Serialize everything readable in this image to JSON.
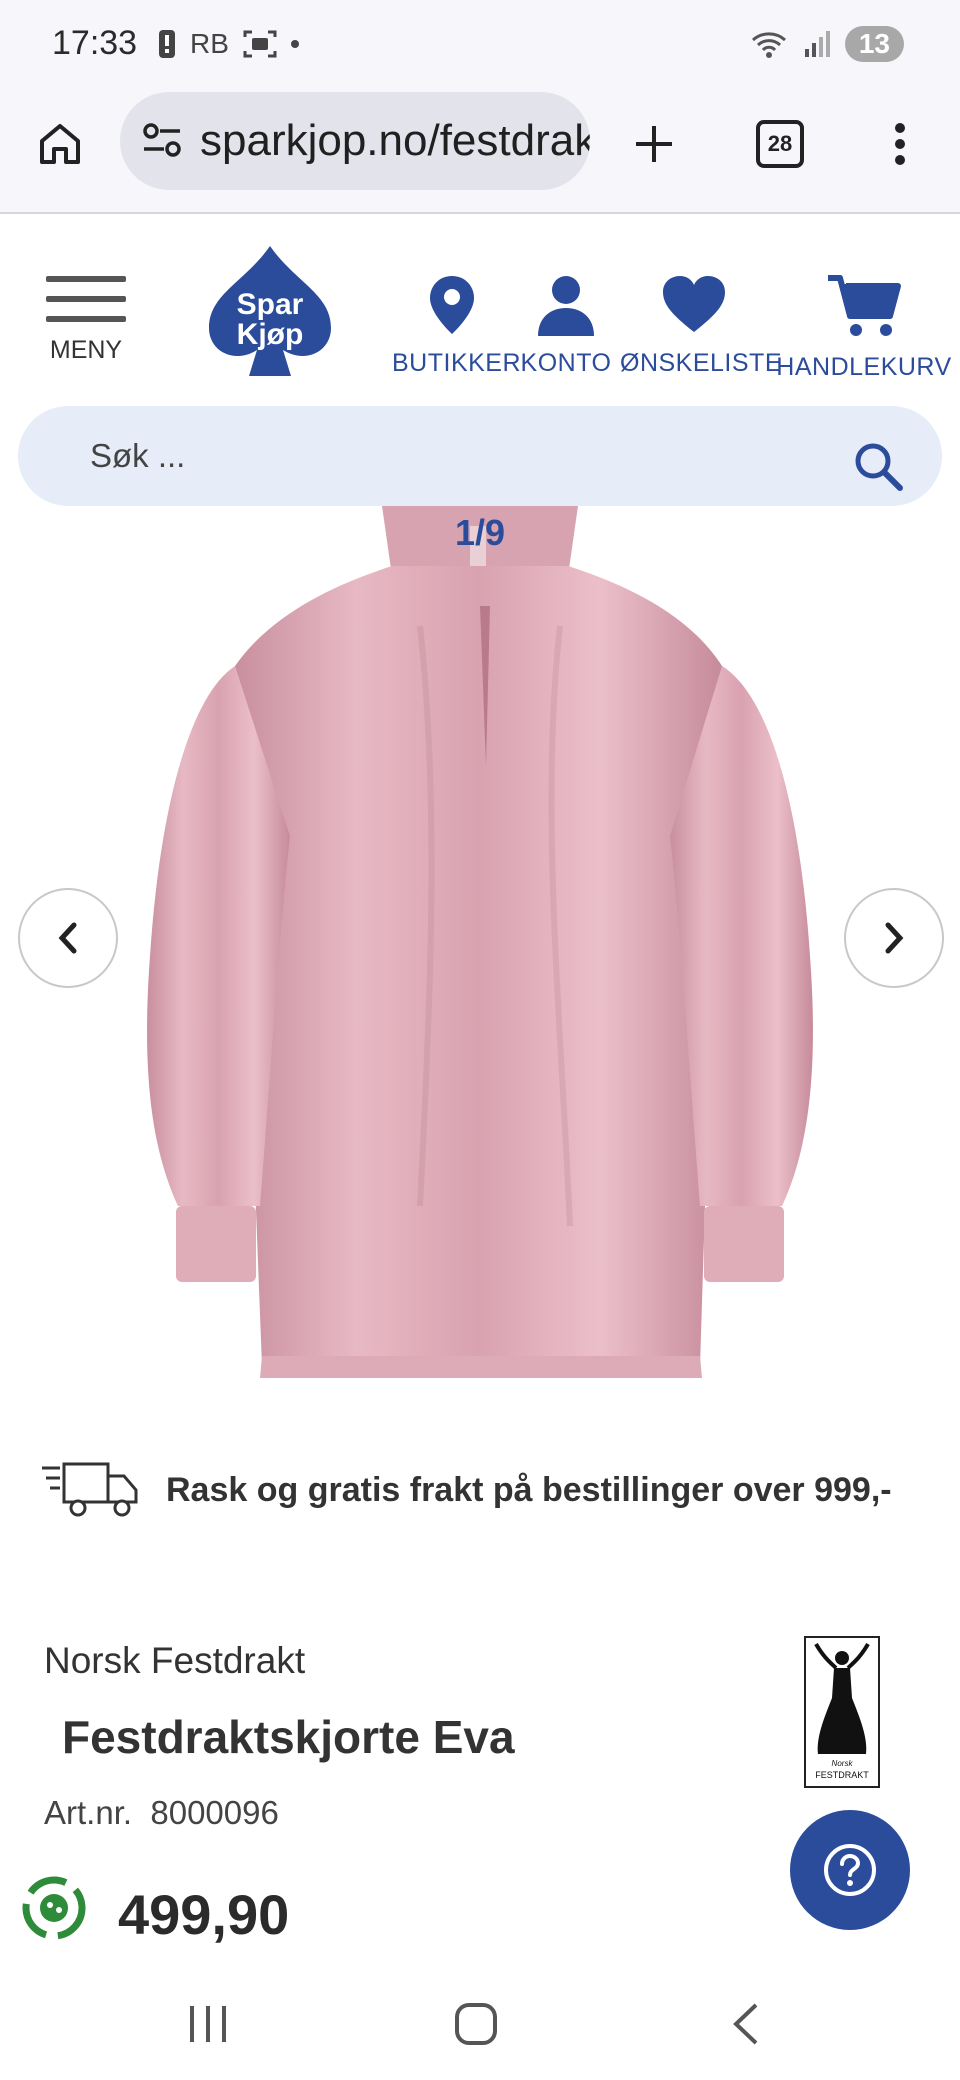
{
  "status_bar": {
    "time": "17:33",
    "carrier": "RB",
    "battery_badge": "13"
  },
  "browser": {
    "url": "sparkjop.no/festdrakt",
    "tab_count": "28"
  },
  "site": {
    "menu_label": "MENY",
    "logo_top": "Spar",
    "logo_bottom": "Kjøp",
    "nav": {
      "stores": "BUTIKKER",
      "account": "KONTO",
      "wishlist": "ØNSKELISTE",
      "cart": "HANDLEKURV"
    },
    "search_placeholder": "Søk ..."
  },
  "gallery": {
    "counter": "1/9"
  },
  "shipping_text": "Rask og gratis frakt på bestillinger over 999,-",
  "product": {
    "brand": "Norsk Festdrakt",
    "title": "Festdraktskjorte Eva",
    "art_label": "Art.nr.",
    "art_number": "8000096",
    "price": "499,90",
    "brand_logo_small": "Norsk",
    "brand_logo_text": "FESTDRAKT"
  },
  "colors": {
    "brand_blue": "#2b4c9b",
    "blouse_pink": "#dfadb9"
  }
}
